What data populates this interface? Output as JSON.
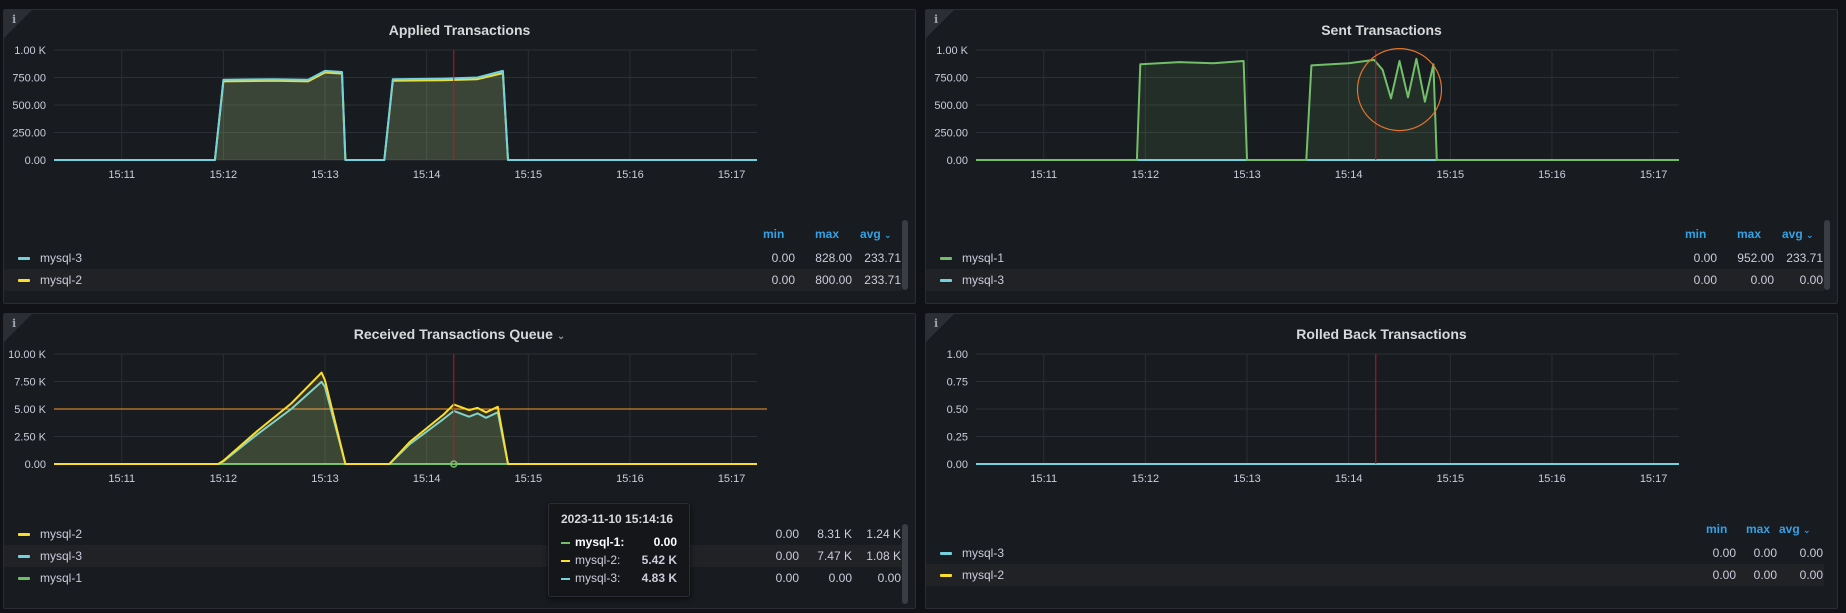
{
  "colors": {
    "mysql-1": "#73bf69",
    "mysql-2": "#fade2a",
    "mysql-3": "#73d2de",
    "accent": "#33a2e5",
    "threshold": "#ff9830",
    "marker": "#c4162a",
    "annotation": "#e0752d"
  },
  "panels": [
    {
      "id": "applied",
      "title": "Applied Transactions",
      "has_dropdown": false,
      "legend_headers": {
        "min": "min",
        "max": "max",
        "avg": "avg"
      },
      "legend": [
        {
          "name": "mysql-3",
          "color": "#73d2de",
          "min": "0.00",
          "max": "828.00",
          "avg": "233.71"
        },
        {
          "name": "mysql-2",
          "color": "#fade2a",
          "min": "0.00",
          "max": "800.00",
          "avg": "233.71"
        }
      ]
    },
    {
      "id": "sent",
      "title": "Sent Transactions",
      "has_dropdown": false,
      "legend_headers": {
        "min": "min",
        "max": "max",
        "avg": "avg"
      },
      "legend": [
        {
          "name": "mysql-1",
          "color": "#73bf69",
          "min": "0.00",
          "max": "952.00",
          "avg": "233.71"
        },
        {
          "name": "mysql-3",
          "color": "#73d2de",
          "min": "0.00",
          "max": "0.00",
          "avg": "0.00"
        }
      ]
    },
    {
      "id": "received",
      "title": "Received Transactions Queue",
      "has_dropdown": true,
      "legend": [
        {
          "name": "mysql-2",
          "color": "#fade2a",
          "min": "0.00",
          "max": "8.31 K",
          "avg": "1.24 K"
        },
        {
          "name": "mysql-3",
          "color": "#73d2de",
          "min": "0.00",
          "max": "7.47 K",
          "avg": "1.08 K"
        },
        {
          "name": "mysql-1",
          "color": "#73bf69",
          "min": "0.00",
          "max": "0.00",
          "avg": "0.00"
        }
      ],
      "tooltip": {
        "time": "2023-11-10 15:14:16",
        "rows": [
          {
            "name": "mysql-1:",
            "value": "0.00",
            "color": "#73bf69"
          },
          {
            "name": "mysql-2:",
            "value": "5.42 K",
            "color": "#fade2a"
          },
          {
            "name": "mysql-3:",
            "value": "4.83 K",
            "color": "#73d2de"
          }
        ]
      }
    },
    {
      "id": "rolledback",
      "title": "Rolled Back Transactions",
      "has_dropdown": false,
      "legend_headers": {
        "min": "min",
        "max": "max",
        "avg": "avg"
      },
      "legend": [
        {
          "name": "mysql-3",
          "color": "#73d2de",
          "min": "0.00",
          "max": "0.00",
          "avg": "0.00"
        },
        {
          "name": "mysql-2",
          "color": "#fade2a",
          "min": "0.00",
          "max": "0.00",
          "avg": "0.00"
        }
      ]
    }
  ],
  "chart_data": [
    {
      "type": "area",
      "title": "Applied Transactions",
      "x_ticks": [
        "15:11",
        "15:12",
        "15:13",
        "15:14",
        "15:15",
        "15:16",
        "15:17"
      ],
      "y_ticks": [
        "0.00",
        "250.00",
        "500.00",
        "750.00",
        "1.00 K"
      ],
      "ylim": [
        0,
        1000
      ],
      "xlim": [
        "15:10:20",
        "15:17:15"
      ],
      "marker_time": "15:14:16",
      "grid": true,
      "series": [
        {
          "name": "mysql-3",
          "points": [
            [
              "15:10:20",
              0
            ],
            [
              "15:11:55",
              0
            ],
            [
              "15:12:00",
              730
            ],
            [
              "15:12:30",
              735
            ],
            [
              "15:12:50",
              730
            ],
            [
              "15:13:00",
              810
            ],
            [
              "15:13:10",
              800
            ],
            [
              "15:13:12",
              0
            ],
            [
              "15:13:35",
              0
            ],
            [
              "15:13:40",
              735
            ],
            [
              "15:14:10",
              740
            ],
            [
              "15:14:30",
              750
            ],
            [
              "15:14:45",
              810
            ],
            [
              "15:14:48",
              0
            ],
            [
              "15:17:15",
              0
            ]
          ]
        },
        {
          "name": "mysql-2",
          "points": [
            [
              "15:10:20",
              0
            ],
            [
              "15:11:55",
              0
            ],
            [
              "15:12:00",
              715
            ],
            [
              "15:12:30",
              720
            ],
            [
              "15:12:50",
              715
            ],
            [
              "15:13:00",
              795
            ],
            [
              "15:13:10",
              785
            ],
            [
              "15:13:12",
              0
            ],
            [
              "15:13:35",
              0
            ],
            [
              "15:13:40",
              720
            ],
            [
              "15:14:10",
              725
            ],
            [
              "15:14:30",
              735
            ],
            [
              "15:14:45",
              790
            ],
            [
              "15:14:48",
              0
            ],
            [
              "15:17:15",
              0
            ]
          ]
        }
      ]
    },
    {
      "type": "area",
      "title": "Sent Transactions",
      "x_ticks": [
        "15:11",
        "15:12",
        "15:13",
        "15:14",
        "15:15",
        "15:16",
        "15:17"
      ],
      "y_ticks": [
        "0.00",
        "250.00",
        "500.00",
        "750.00",
        "1.00 K"
      ],
      "ylim": [
        0,
        1000
      ],
      "xlim": [
        "15:10:20",
        "15:17:15"
      ],
      "marker_time": "15:14:16",
      "grid": true,
      "annotation": {
        "shape": "circle",
        "at": [
          "15:14:30",
          640
        ]
      },
      "series": [
        {
          "name": "mysql-1",
          "points": [
            [
              "15:10:20",
              0
            ],
            [
              "15:11:55",
              0
            ],
            [
              "15:11:57",
              870
            ],
            [
              "15:12:20",
              890
            ],
            [
              "15:12:40",
              880
            ],
            [
              "15:12:58",
              900
            ],
            [
              "15:13:00",
              0
            ],
            [
              "15:13:35",
              0
            ],
            [
              "15:13:38",
              860
            ],
            [
              "15:14:00",
              880
            ],
            [
              "15:14:15",
              910
            ],
            [
              "15:14:20",
              820
            ],
            [
              "15:14:25",
              560
            ],
            [
              "15:14:30",
              900
            ],
            [
              "15:14:35",
              570
            ],
            [
              "15:14:40",
              920
            ],
            [
              "15:14:45",
              530
            ],
            [
              "15:14:50",
              870
            ],
            [
              "15:14:52",
              0
            ],
            [
              "15:17:15",
              0
            ]
          ]
        },
        {
          "name": "mysql-3",
          "points": [
            [
              "15:10:20",
              0
            ],
            [
              "15:17:15",
              0
            ]
          ]
        }
      ]
    },
    {
      "type": "area",
      "title": "Received Transactions Queue",
      "x_ticks": [
        "15:11",
        "15:12",
        "15:13",
        "15:14",
        "15:15",
        "15:16",
        "15:17"
      ],
      "y_ticks": [
        "0.00",
        "2.50 K",
        "5.00 K",
        "7.50 K",
        "10.00 K"
      ],
      "ylim": [
        0,
        10000
      ],
      "xlim": [
        "15:10:20",
        "15:17:15"
      ],
      "marker_time": "15:14:16",
      "threshold": 5000,
      "grid": true,
      "series": [
        {
          "name": "mysql-2",
          "points": [
            [
              "15:10:20",
              0
            ],
            [
              "15:11:57",
              0
            ],
            [
              "15:12:00",
              300
            ],
            [
              "15:12:20",
              3000
            ],
            [
              "15:12:40",
              5500
            ],
            [
              "15:12:58",
              8310
            ],
            [
              "15:13:00",
              7600
            ],
            [
              "15:13:12",
              0
            ],
            [
              "15:13:38",
              0
            ],
            [
              "15:13:50",
              2000
            ],
            [
              "15:14:10",
              4500
            ],
            [
              "15:14:16",
              5420
            ],
            [
              "15:14:25",
              4900
            ],
            [
              "15:14:30",
              5100
            ],
            [
              "15:14:35",
              4700
            ],
            [
              "15:14:42",
              5200
            ],
            [
              "15:14:48",
              0
            ],
            [
              "15:17:15",
              0
            ]
          ]
        },
        {
          "name": "mysql-3",
          "points": [
            [
              "15:10:20",
              0
            ],
            [
              "15:11:57",
              0
            ],
            [
              "15:12:00",
              250
            ],
            [
              "15:12:20",
              2700
            ],
            [
              "15:12:40",
              5000
            ],
            [
              "15:12:58",
              7470
            ],
            [
              "15:13:00",
              7000
            ],
            [
              "15:13:12",
              0
            ],
            [
              "15:13:38",
              0
            ],
            [
              "15:13:50",
              1800
            ],
            [
              "15:14:10",
              4100
            ],
            [
              "15:14:16",
              4830
            ],
            [
              "15:14:25",
              4300
            ],
            [
              "15:14:30",
              4600
            ],
            [
              "15:14:35",
              4200
            ],
            [
              "15:14:42",
              4700
            ],
            [
              "15:14:48",
              0
            ],
            [
              "15:17:15",
              0
            ]
          ]
        },
        {
          "name": "mysql-1",
          "points": [
            [
              "15:10:20",
              0
            ],
            [
              "15:17:15",
              0
            ]
          ]
        }
      ]
    },
    {
      "type": "line",
      "title": "Rolled Back Transactions",
      "x_ticks": [
        "15:11",
        "15:12",
        "15:13",
        "15:14",
        "15:15",
        "15:16",
        "15:17"
      ],
      "y_ticks": [
        "0.00",
        "0.25",
        "0.50",
        "0.75",
        "1.00"
      ],
      "ylim": [
        0,
        1
      ],
      "xlim": [
        "15:10:20",
        "15:17:15"
      ],
      "marker_time": "15:14:16",
      "grid": true,
      "series": [
        {
          "name": "mysql-3",
          "points": [
            [
              "15:10:20",
              0
            ],
            [
              "15:17:15",
              0
            ]
          ]
        },
        {
          "name": "mysql-2",
          "points": [
            [
              "15:10:20",
              0
            ],
            [
              "15:17:15",
              0
            ]
          ]
        }
      ]
    }
  ]
}
